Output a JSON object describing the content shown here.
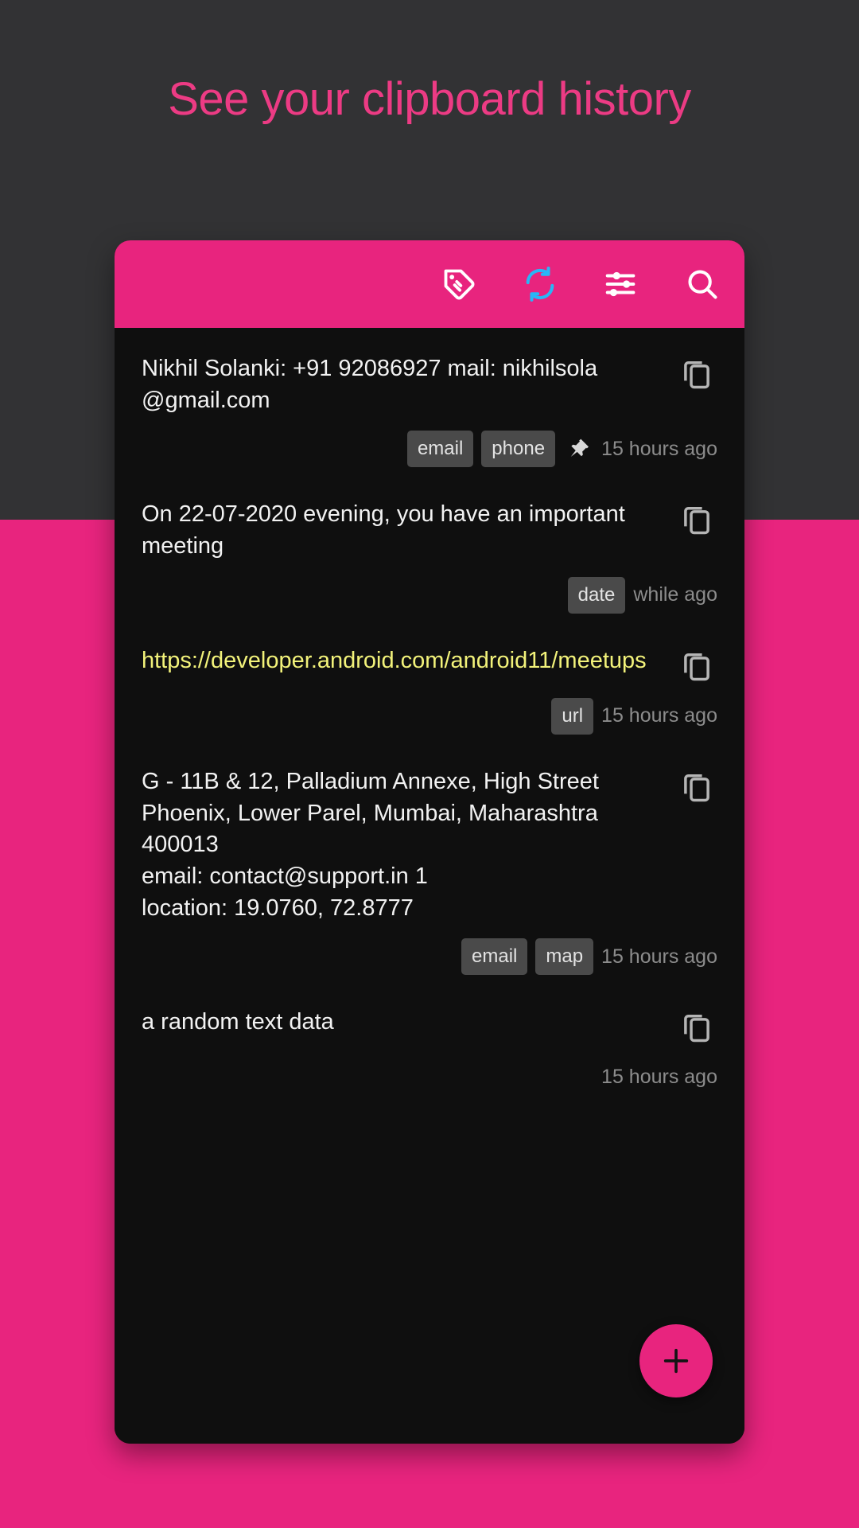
{
  "headline": "See your clipboard history",
  "colors": {
    "accent_pink": "#e8247e",
    "headline_pink": "#ec3b84",
    "backdrop_dark": "#323234",
    "card_dark": "#0f0f0f",
    "tag_gray": "#4a4a4a",
    "url_yellow": "#f2f27a",
    "sync_blue": "#29b6f6",
    "time_gray": "#8c8c8c"
  },
  "app_bar": {
    "icons": [
      {
        "name": "tag-icon",
        "label": "Tags"
      },
      {
        "name": "sync-icon",
        "label": "Sync"
      },
      {
        "name": "tune-icon",
        "label": "Filter"
      },
      {
        "name": "search-icon",
        "label": "Search"
      }
    ]
  },
  "clips": [
    {
      "text": "Nikhil Solanki: +91 92086927    mail: nikhilsola    @gmail.com",
      "kind": "text",
      "tags": [
        "email",
        "phone"
      ],
      "pinned": true,
      "time": "15 hours ago",
      "copy_label": "copy-icon"
    },
    {
      "text": "On 22-07-2020 evening, you have an important meeting",
      "kind": "text",
      "tags": [
        "date"
      ],
      "pinned": false,
      "time": "while ago",
      "copy_label": "copy-icon"
    },
    {
      "text": "https://developer.android.com/android11/meetups",
      "kind": "url",
      "tags": [
        "url"
      ],
      "pinned": false,
      "time": "15 hours ago",
      "copy_label": "copy-icon"
    },
    {
      "text": "G - 11B & 12, Palladium Annexe, High Street Phoenix, Lower Parel, Mumbai, Maharashtra 400013\nemail: contact@support.in 1\nlocation: 19.0760, 72.8777",
      "kind": "text",
      "tags": [
        "email",
        "map"
      ],
      "pinned": false,
      "time": "15 hours ago",
      "copy_label": "copy-icon"
    },
    {
      "text": "a random text data",
      "kind": "text",
      "tags": [],
      "pinned": false,
      "time": "15 hours ago",
      "copy_label": "copy-icon"
    }
  ],
  "fab": {
    "name": "add-button",
    "label": "+"
  }
}
